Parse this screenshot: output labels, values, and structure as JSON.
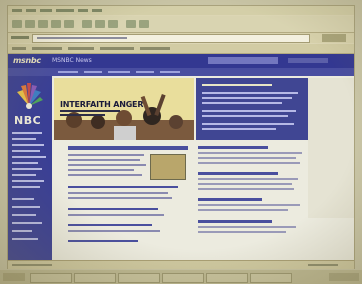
{
  "site": {
    "logo": "msnbc",
    "section_tab": "MSNBC News",
    "network_logo": "NBC"
  },
  "lead_story": {
    "headline": "INTERFAITH ANGER"
  },
  "icons": [
    "nbc-peacock-icon"
  ],
  "colors": {
    "brand_navy": "#333891",
    "sidebar": "#3a3f95",
    "banner_yellow": "#e7dc96"
  }
}
